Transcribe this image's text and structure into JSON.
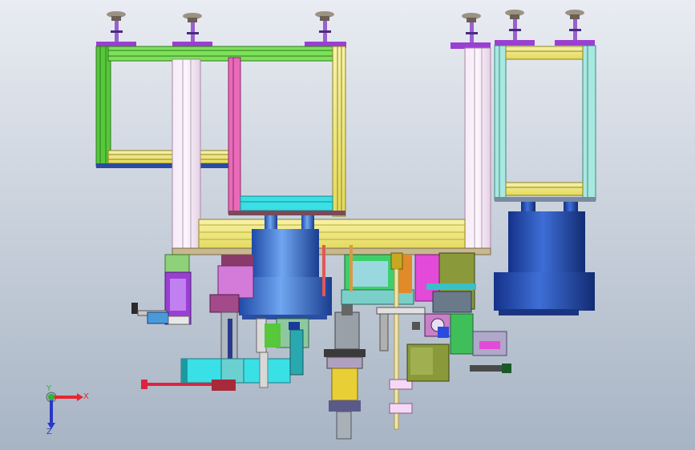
{
  "viewport": {
    "background_top": "#e9ecf2",
    "background_bottom": "#a7b4c4"
  },
  "triad": {
    "x_label": "X",
    "y_label": "Y",
    "z_label": "Z",
    "x_color": "#e8262e",
    "y_color": "#2fb53a",
    "z_color": "#2a36c9"
  },
  "palette": {
    "purple": "#9a3fd1",
    "green": "#56c83a",
    "yellow": "#f2ee8e",
    "pink": "#f2dff2",
    "cyan": "#39e0e6",
    "blue": "#3d78d8",
    "navy": "#1f4aa8",
    "gold": "#e9cf36",
    "magenta": "#e34ad8",
    "olive": "#8f9a3a",
    "red": "#de2340"
  }
}
